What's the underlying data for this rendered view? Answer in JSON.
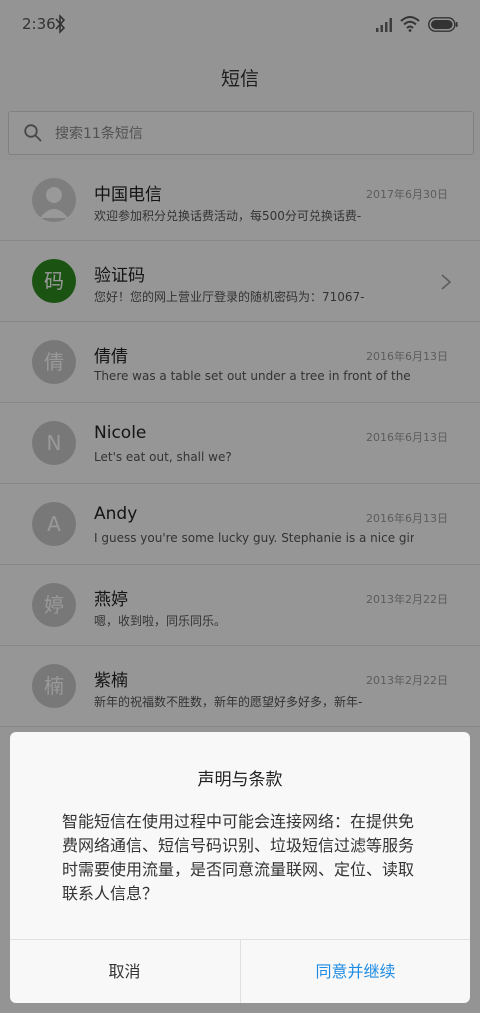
{
  "status_bar": {
    "time": "2:36"
  },
  "header": {
    "title": "短信"
  },
  "search": {
    "placeholder": "搜索11条短信"
  },
  "conversations": [
    {
      "name": "中国电信",
      "preview": "欢迎参加积分兑换话费活动，每500分可兑换话费-",
      "date": "2017年6月30日",
      "avatar": "",
      "avatar_type": "person"
    },
    {
      "name": "验证码",
      "preview": "您好！您的网上营业厅登录的随机密码为：71067-",
      "date": "",
      "avatar": "码",
      "avatar_type": "green",
      "has_chevron": true
    },
    {
      "name": "倩倩",
      "preview": "There was a table set out under a tree in front of the ho-",
      "date": "2016年6月13日",
      "avatar": "倩",
      "avatar_type": "gray"
    },
    {
      "name": "Nicole",
      "preview": "Let's eat out, shall we?",
      "date": "2016年6月13日",
      "avatar": "N",
      "avatar_type": "gray"
    },
    {
      "name": "Andy",
      "preview": "I guess you're some lucky guy. Stephanie is a nice girl.",
      "date": "2016年6月13日",
      "avatar": "A",
      "avatar_type": "gray"
    },
    {
      "name": "燕婷",
      "preview": "嗯，收到啦，同乐同乐。",
      "date": "2013年2月22日",
      "avatar": "婷",
      "avatar_type": "gray"
    },
    {
      "name": "紫楠",
      "preview": "新年的祝福数不胜数，新年的愿望好多好多，新年-",
      "date": "2013年2月22日",
      "avatar": "楠",
      "avatar_type": "gray"
    }
  ],
  "dialog": {
    "title": "声明与条款",
    "body": "智能短信在使用过程中可能会连接网络：在提供免费网络通信、短信号码识别、垃圾短信过滤等服务时需要使用流量，是否同意流量联网、定位、读取联系人信息？",
    "cancel_label": "取消",
    "agree_label": "同意并继续"
  }
}
